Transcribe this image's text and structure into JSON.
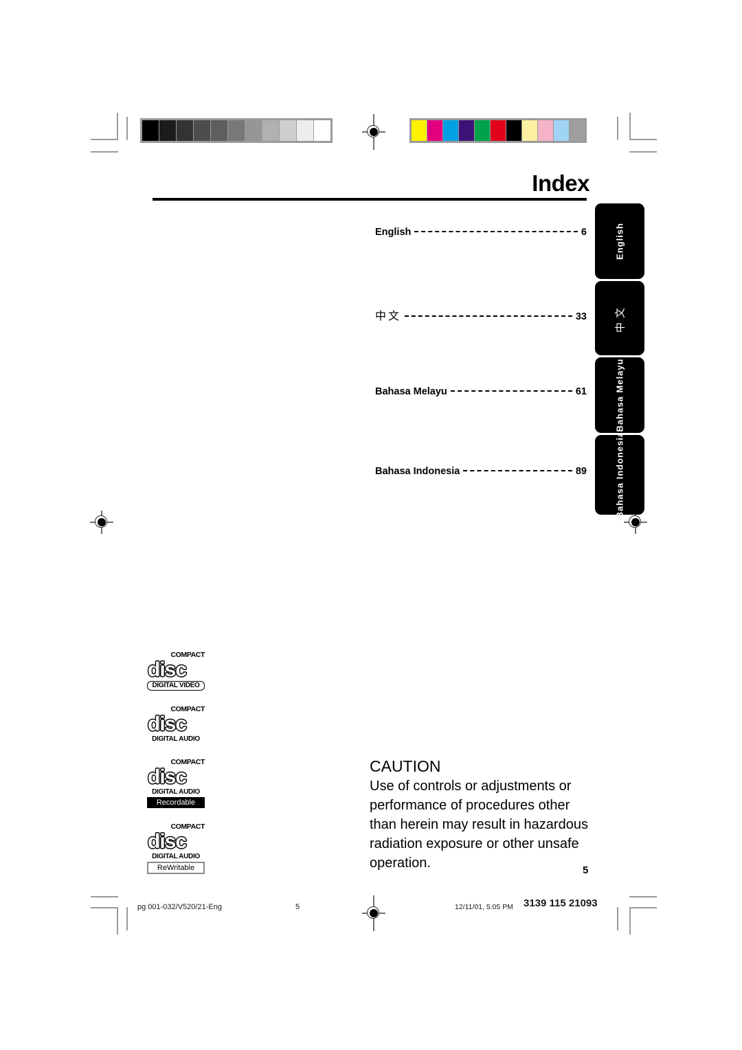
{
  "document": {
    "title": "Index",
    "page_number": "5"
  },
  "calibration": {
    "grayscale_label": "grayscale-calibration-bar",
    "grayscale": [
      "#000000",
      "#1c1c1c",
      "#333333",
      "#4d4d4d",
      "#5e5e5e",
      "#787878",
      "#969696",
      "#b1b1b1",
      "#cfcfcf",
      "#ededed",
      "#ffffff"
    ],
    "color_label": "color-calibration-bar",
    "colors": [
      "#fff200",
      "#e3007f",
      "#00a0e3",
      "#3d1276",
      "#00a14b",
      "#e2001a",
      "#000000",
      "#fbf0a0",
      "#f5b2c8",
      "#9fd4f5",
      "#9e9e9e"
    ]
  },
  "index": {
    "entries": [
      {
        "label": "English",
        "page": "6",
        "tab": "English",
        "script": "latin"
      },
      {
        "label": "中文",
        "page": "33",
        "tab": "中文",
        "script": "cjk"
      },
      {
        "label": "Bahasa Melayu",
        "page": "61",
        "tab": "Bahasa Melayu",
        "script": "latin"
      },
      {
        "label": "Bahasa Indonesia",
        "page": "89",
        "tab": "Bahasa Indonesia",
        "script": "latin"
      }
    ]
  },
  "logos": [
    {
      "word": "disc",
      "compact": "COMPACT",
      "sub": "DIGITAL VIDEO",
      "sub_style": "boxed",
      "badge": "",
      "badge_style": ""
    },
    {
      "word": "disc",
      "compact": "COMPACT",
      "sub": "DIGITAL AUDIO",
      "sub_style": "plain",
      "badge": "",
      "badge_style": ""
    },
    {
      "word": "disc",
      "compact": "COMPACT",
      "sub": "DIGITAL AUDIO",
      "sub_style": "plain",
      "badge": "Recordable",
      "badge_style": "invert"
    },
    {
      "word": "disc",
      "compact": "COMPACT",
      "sub": "DIGITAL AUDIO",
      "sub_style": "plain",
      "badge": "ReWritable",
      "badge_style": "outline"
    }
  ],
  "caution": {
    "heading": "CAUTION",
    "body": "Use of controls or adjustments or performance of procedures other than herein may result in hazardous radiation exposure or other unsafe operation."
  },
  "footer": {
    "doc_id": "pg 001-032/V520/21-Eng",
    "page": "5",
    "timestamp": "12/11/01, 5:05 PM",
    "code": "3139 115 21093"
  }
}
